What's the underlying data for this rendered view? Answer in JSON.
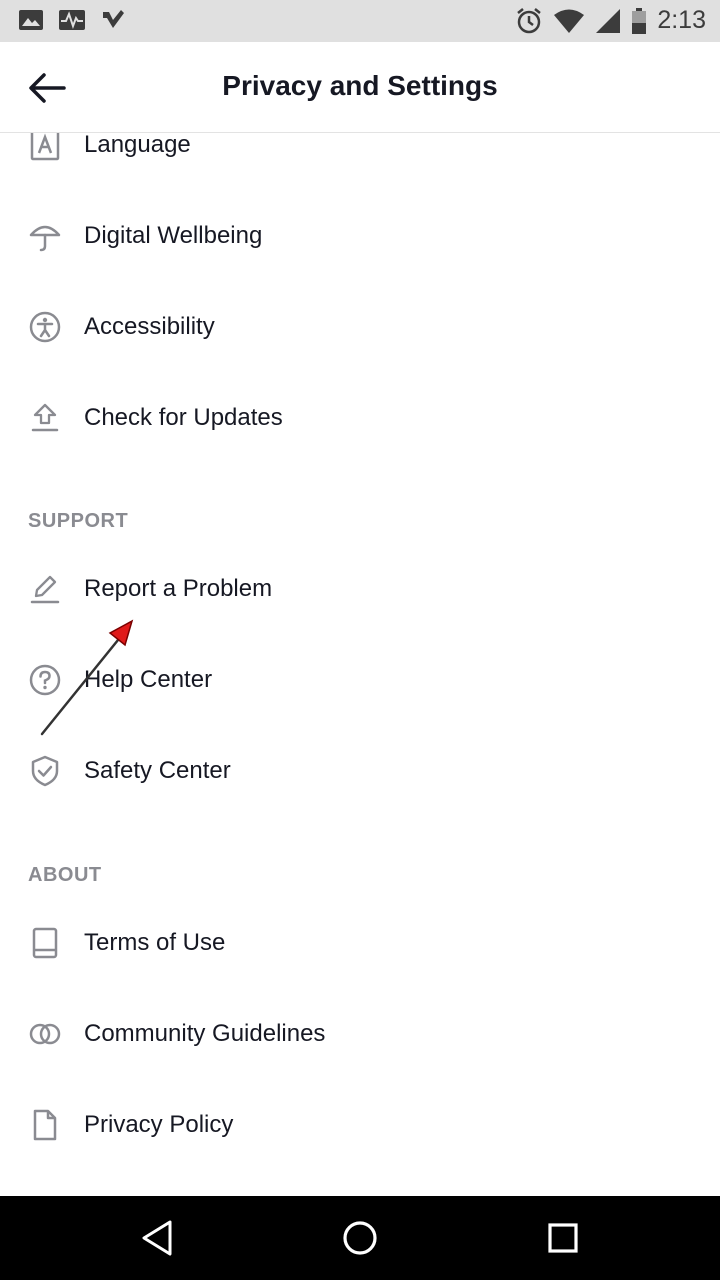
{
  "status_bar": {
    "time": "2:13",
    "left_icons": [
      "image-icon",
      "activity-icon",
      "check-notification-icon"
    ],
    "right_icons": [
      "alarm-icon",
      "wifi-icon",
      "signal-icon",
      "battery-icon"
    ]
  },
  "header": {
    "title": "Privacy and Settings",
    "back_icon": "back-arrow-icon"
  },
  "general_items": [
    {
      "label": "Language",
      "icon": "language-icon"
    },
    {
      "label": "Digital Wellbeing",
      "icon": "umbrella-icon"
    },
    {
      "label": "Accessibility",
      "icon": "accessibility-icon"
    },
    {
      "label": "Check for Updates",
      "icon": "upload-icon"
    }
  ],
  "support": {
    "header": "SUPPORT",
    "items": [
      {
        "label": "Report a Problem",
        "icon": "pencil-icon"
      },
      {
        "label": "Help Center",
        "icon": "help-icon"
      },
      {
        "label": "Safety Center",
        "icon": "shield-icon"
      }
    ]
  },
  "about": {
    "header": "ABOUT",
    "items": [
      {
        "label": "Terms of Use",
        "icon": "book-icon"
      },
      {
        "label": "Community Guidelines",
        "icon": "rings-icon"
      },
      {
        "label": "Privacy Policy",
        "icon": "document-icon"
      }
    ]
  },
  "nav_bar": {
    "buttons": [
      "back-triangle-icon",
      "home-circle-icon",
      "recents-square-icon"
    ]
  },
  "colors": {
    "text": "#161823",
    "section_header": "#8a8b91",
    "icon": "#8a8b91",
    "annotation_arrow": "#e01a1a"
  }
}
